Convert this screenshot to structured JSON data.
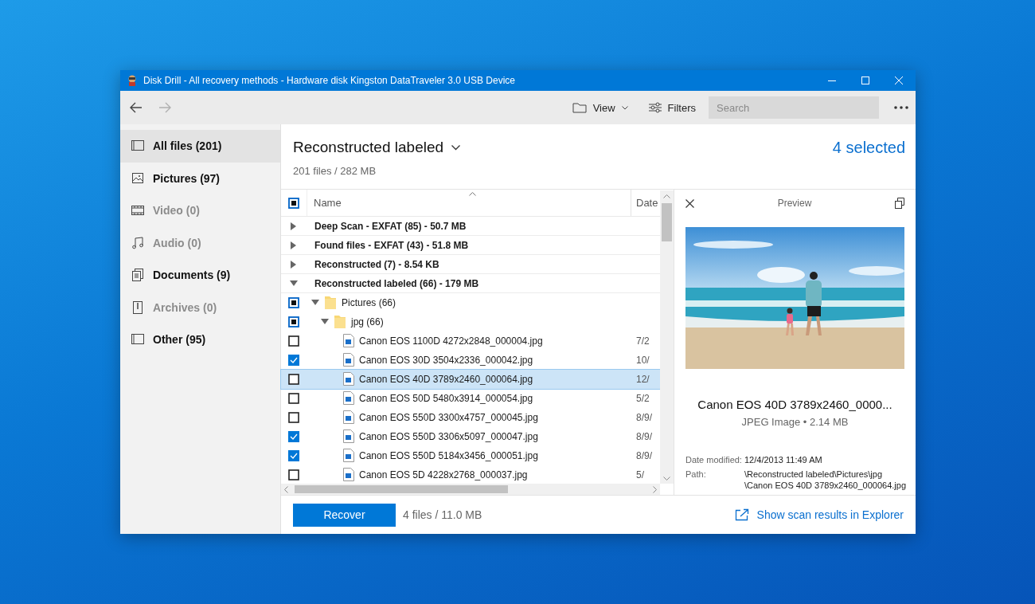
{
  "window": {
    "title": "Disk Drill - All recovery methods - Hardware disk Kingston DataTraveler 3.0 USB Device"
  },
  "toolbar": {
    "view": "View",
    "filters": "Filters",
    "search_placeholder": "Search",
    "forward_disabled": true
  },
  "sidebar": {
    "items": [
      {
        "kind": "all",
        "label": "All files (201)",
        "selected": true,
        "disabled": false
      },
      {
        "kind": "pictures",
        "label": "Pictures (97)",
        "selected": false,
        "disabled": false
      },
      {
        "kind": "video",
        "label": "Video (0)",
        "selected": false,
        "disabled": true
      },
      {
        "kind": "audio",
        "label": "Audio (0)",
        "selected": false,
        "disabled": true
      },
      {
        "kind": "documents",
        "label": "Documents (9)",
        "selected": false,
        "disabled": false
      },
      {
        "kind": "archives",
        "label": "Archives (0)",
        "selected": false,
        "disabled": true
      },
      {
        "kind": "other",
        "label": "Other (95)",
        "selected": false,
        "disabled": false
      }
    ]
  },
  "header": {
    "title": "Reconstructed labeled",
    "summary": "201 files / 282 MB",
    "selection": "4 selected"
  },
  "table": {
    "columns": [
      "Name",
      "Date"
    ],
    "header_checkbox": {
      "checked": false,
      "partial": true
    },
    "rows": [
      {
        "kind": "group",
        "label": "Deep Scan - EXFAT (85) - 50.7 MB",
        "expanded": false
      },
      {
        "kind": "group",
        "label": "Found files - EXFAT (43) - 51.8 MB",
        "expanded": false
      },
      {
        "kind": "group",
        "label": "Reconstructed (7) - 8.54 KB",
        "expanded": false
      },
      {
        "kind": "group",
        "label": "Reconstructed labeled (66) - 179 MB",
        "expanded": true,
        "children": [
          {
            "kind": "folder",
            "label": "Pictures (66)",
            "expanded": true,
            "checked": false,
            "partial": true,
            "children": [
              {
                "kind": "folder",
                "label": "jpg (66)",
                "expanded": true,
                "checked": false,
                "partial": true,
                "children": [
                  {
                    "kind": "file",
                    "label": "Canon EOS 1100D 4272x2848_000004.jpg",
                    "date": "7/2",
                    "checked": false,
                    "selected": false
                  },
                  {
                    "kind": "file",
                    "label": "Canon EOS 30D 3504x2336_000042.jpg",
                    "date": "10/",
                    "checked": true,
                    "selected": false
                  },
                  {
                    "kind": "file",
                    "label": "Canon EOS 40D 3789x2460_000064.jpg",
                    "date": "12/",
                    "checked": false,
                    "selected": true
                  },
                  {
                    "kind": "file",
                    "label": "Canon EOS 50D 5480x3914_000054.jpg",
                    "date": "5/2",
                    "checked": false,
                    "selected": false
                  },
                  {
                    "kind": "file",
                    "label": "Canon EOS 550D 3300x4757_000045.jpg",
                    "date": "8/9/",
                    "checked": false,
                    "selected": false
                  },
                  {
                    "kind": "file",
                    "label": "Canon EOS 550D 3306x5097_000047.jpg",
                    "date": "8/9/",
                    "checked": true,
                    "selected": false
                  },
                  {
                    "kind": "file",
                    "label": "Canon EOS 550D 5184x3456_000051.jpg",
                    "date": "8/9/",
                    "checked": true,
                    "selected": false
                  },
                  {
                    "kind": "file",
                    "label": "Canon EOS 5D 4228x2768_000037.jpg",
                    "date": "5/",
                    "checked": false,
                    "selected": false
                  }
                ]
              }
            ]
          }
        ]
      }
    ]
  },
  "preview": {
    "title": "Preview",
    "file_name": "Canon EOS 40D 3789x2460_0000...",
    "file_type": "JPEG Image • 2.14 MB",
    "details": [
      {
        "label": "Date modified:",
        "lines": [
          "12/4/2013 11:49 AM"
        ]
      },
      {
        "label": "Path:",
        "lines": [
          "\\Reconstructed labeled\\Pictures\\jpg",
          "\\Canon EOS 40D 3789x2460_000064.jpg"
        ]
      }
    ]
  },
  "footer": {
    "recover": "Recover",
    "summary": "4 files / 11.0 MB",
    "explorer_link": "Show scan results in Explorer"
  }
}
